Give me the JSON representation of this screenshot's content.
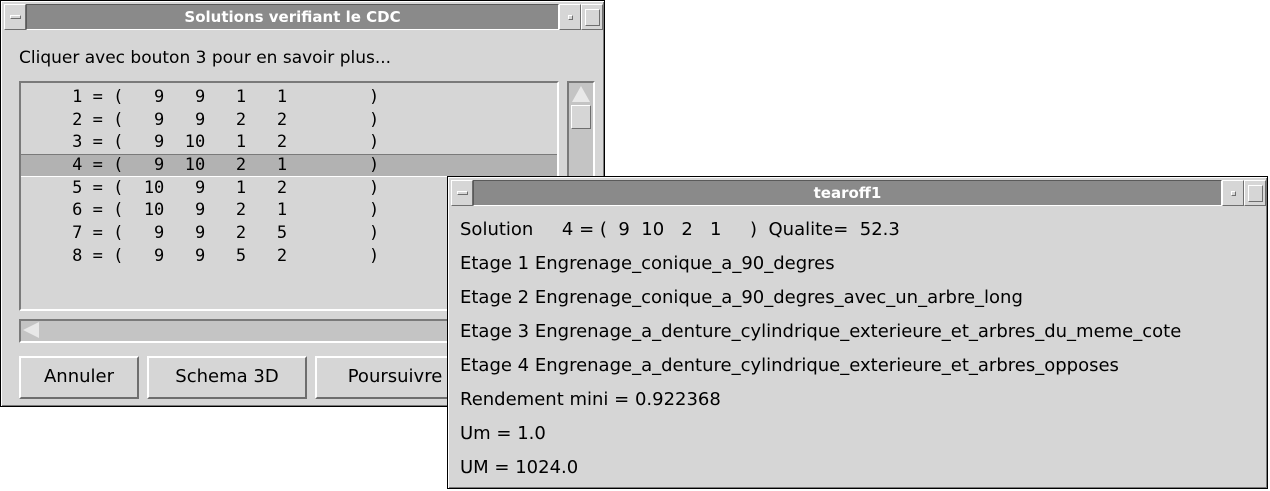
{
  "solutions_window": {
    "title": "Solutions verifiant le CDC",
    "hint": "Cliquer avec bouton 3 pour en savoir plus...",
    "rows": [
      {
        "text": "     1 = (   9   9   1   1        )",
        "selected": false
      },
      {
        "text": "     2 = (   9   9   2   2        )",
        "selected": false
      },
      {
        "text": "     3 = (   9  10   1   2        )",
        "selected": false
      },
      {
        "text": "     4 = (   9  10   2   1        )",
        "selected": true
      },
      {
        "text": "     5 = (  10   9   1   2        )",
        "selected": false
      },
      {
        "text": "     6 = (  10   9   2   1        )",
        "selected": false
      },
      {
        "text": "     7 = (   9   9   2   5        )",
        "selected": false
      },
      {
        "text": "     8 = (   9   9   5   2        )",
        "selected": false
      }
    ],
    "buttons": {
      "cancel": "Annuler",
      "schema": "Schema 3D",
      "continue": "Poursuivre"
    }
  },
  "tearoff_window": {
    "title": "tearoff1",
    "lines": [
      "Solution     4 = (  9  10   2   1     )  Qualite=  52.3",
      "Etage 1 Engrenage_conique_a_90_degres",
      "Etage 2 Engrenage_conique_a_90_degres_avec_un_arbre_long",
      "Etage 3 Engrenage_a_denture_cylindrique_exterieure_et_arbres_du_meme_cote",
      "Etage 4 Engrenage_a_denture_cylindrique_exterieure_et_arbres_opposes",
      "Rendement mini = 0.922368",
      "Um = 1.0",
      "UM = 1024.0"
    ]
  }
}
